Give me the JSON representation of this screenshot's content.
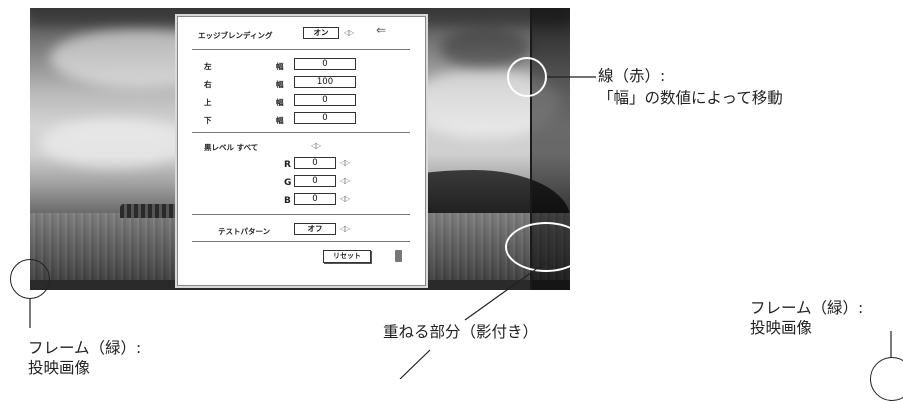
{
  "menu": {
    "edge_blending_label": "エッジブレンディング",
    "edge_blending_value": "オン",
    "back_icon": "left-arrow-icon",
    "adjust_icon": "left-right-arrows-icon",
    "width_label": "幅",
    "rows": [
      {
        "side": "左",
        "value": "0"
      },
      {
        "side": "右",
        "value": "100"
      },
      {
        "side": "上",
        "value": "0"
      },
      {
        "side": "下",
        "value": "0"
      }
    ],
    "black_level_label": "黒レベル すべて",
    "rgb": [
      {
        "channel": "R",
        "value": "0"
      },
      {
        "channel": "G",
        "value": "0"
      },
      {
        "channel": "B",
        "value": "0"
      }
    ],
    "test_pattern_label": "テストパターン",
    "test_pattern_value": "オフ",
    "reset_label": "リセット",
    "exit_icon": "exit-door-icon"
  },
  "annotations": {
    "red_line_title": "線（赤）:",
    "red_line_desc": "「幅」の数値によって移動",
    "overlap_label": "重ねる部分（影付き）",
    "frame_left_line1": "フレーム（緑）:",
    "frame_left_line2": "投映画像",
    "frame_right_line1": "フレーム（緑）:",
    "frame_right_line2": "投映画像"
  },
  "colors": {
    "annotation_text": "#222222",
    "menu_border": "#888888"
  }
}
